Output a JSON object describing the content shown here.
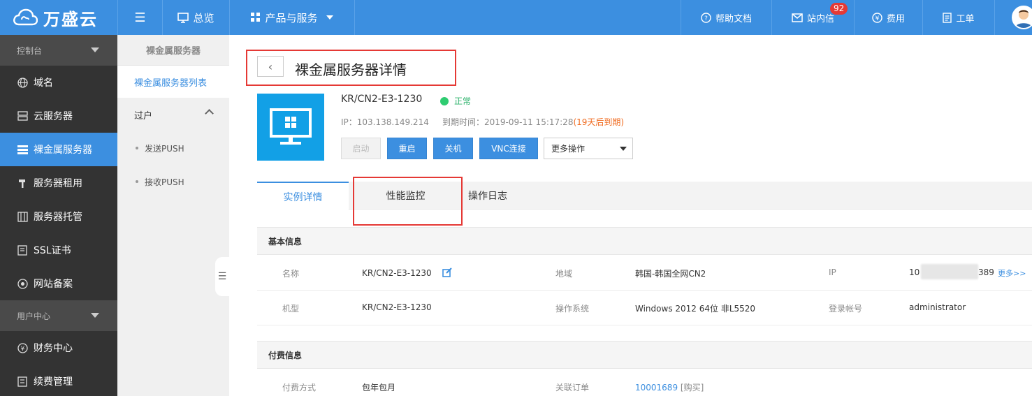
{
  "brand": {
    "name": "万盛云"
  },
  "topnav": {
    "overview": "总览",
    "products": "产品与服务",
    "help": "帮助文档",
    "messages": "站内信",
    "message_count": "92",
    "billing": "费用",
    "tickets": "工单"
  },
  "sidebar": {
    "section1": "控制台",
    "items": [
      {
        "label": "域名",
        "icon": "globe-icon"
      },
      {
        "label": "云服务器",
        "icon": "server-icon"
      },
      {
        "label": "裸金属服务器",
        "icon": "list-icon"
      },
      {
        "label": "服务器租用",
        "icon": "hammer-icon"
      },
      {
        "label": "服务器托管",
        "icon": "rack-icon"
      },
      {
        "label": "SSL证书",
        "icon": "certificate-icon"
      },
      {
        "label": "网站备案",
        "icon": "record-icon"
      }
    ],
    "section2": "用户中心",
    "items2": [
      {
        "label": "财务中心",
        "icon": "yen-icon"
      },
      {
        "label": "续费管理",
        "icon": "renew-icon"
      }
    ]
  },
  "subnav": {
    "title": "裸金属服务器",
    "active_link": "裸金属服务器列表",
    "group": "过户",
    "children": [
      "发送PUSH",
      "接收PUSH"
    ]
  },
  "page": {
    "title": "裸金属服务器详情",
    "server_name": "KR/CN2-E3-1230",
    "status": "正常",
    "ip_line": "IP：103.138.149.214",
    "expire_label": "到期时间：2019-09-11 15:17:28",
    "expire_warn": "(19天后到期)",
    "buttons": {
      "start": "启动",
      "restart": "重启",
      "shutdown": "关机",
      "vnc": "VNC连接"
    },
    "more_ops": "更多操作"
  },
  "tabs": [
    "实例详情",
    "性能监控",
    "操作日志"
  ],
  "basic": {
    "heading": "基本信息",
    "name_label": "名称",
    "name_value": "KR/CN2-E3-1230",
    "region_label": "地域",
    "region_value": "韩国-韩国全网CN2",
    "ip_label": "IP",
    "ip_prefix": "10",
    "ip_suffix": "389",
    "ip_more": "更多>>",
    "model_label": "机型",
    "model_value": "KR/CN2-E3-1230",
    "os_label": "操作系统",
    "os_value": "Windows 2012 64位 非L5520",
    "login_label": "登录帐号",
    "login_value": "administrator"
  },
  "billing": {
    "heading": "付费信息",
    "pay_label": "付费方式",
    "pay_value": "包年包月",
    "order_label": "关联订单",
    "order_value": "10001689",
    "order_buy": "[购买]"
  },
  "colors": {
    "accent": "#3c8fe0",
    "sidebar": "#333333",
    "highlight": "#e53935",
    "ok": "#2ecc71",
    "warn": "#f06a1e"
  }
}
